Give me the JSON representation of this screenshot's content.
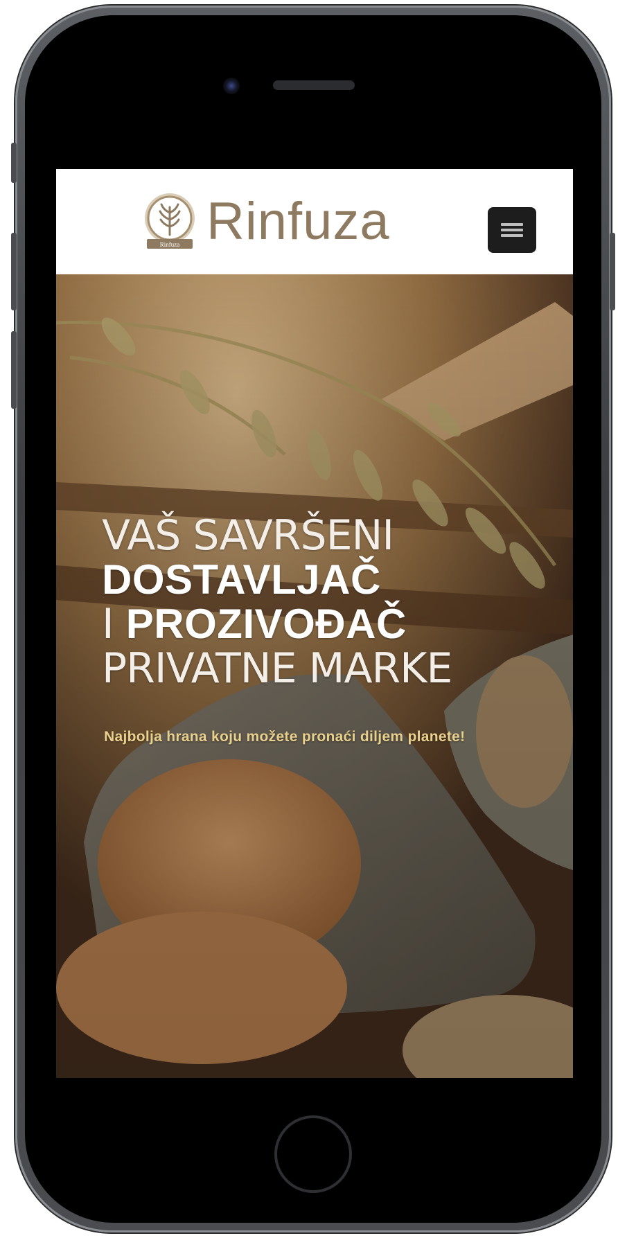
{
  "header": {
    "logo_text": "Rinfuza",
    "logo_badge_text": "Rinfuza",
    "menu_icon": "hamburger-menu-icon"
  },
  "hero": {
    "line1": "VAŠ SAVRŠENI",
    "line2": "DOSTAVLJAČ",
    "line3_prefix": "I ",
    "line3_bold": "PROZIVOĐAČ",
    "line4": "PRIVATNE MARKE",
    "tagline": "Najbolja hrana koju možete pronaći diljem planete!",
    "background": "grain-sacks-photo"
  },
  "colors": {
    "brand": "#8d7a60",
    "tagline": "#e9d08c",
    "menu_button": "#1d1d1d"
  }
}
